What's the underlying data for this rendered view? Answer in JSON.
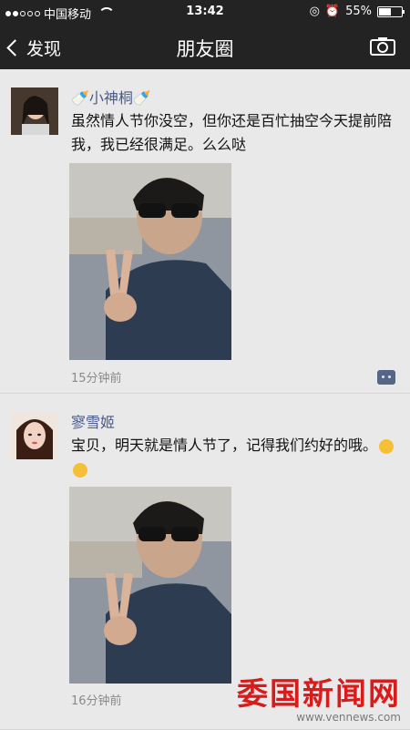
{
  "statusbar": {
    "carrier": "中国移动",
    "time": "13:42",
    "battery_text": "55%",
    "battery_level": 0.55
  },
  "navbar": {
    "back_label": "发现",
    "title": "朋友圈",
    "camera_icon": "camera-icon"
  },
  "posts": [
    {
      "author": "🍼小神桐🍼",
      "text": "虽然情人节你没空，但你还是百忙抽空今天提前陪我，我已经很满足。么么哒",
      "time": "15分钟前"
    },
    {
      "author": "寥雪姬",
      "text": "宝贝，明天就是情人节了，记得我们约好的哦",
      "text_tail": "。",
      "time": "16分钟前"
    }
  ],
  "watermark": {
    "cn": "委国新闻网",
    "url": "www.vennews.com"
  },
  "colors": {
    "nav_bg": "#232323",
    "name_blue": "#4a5a8a",
    "page_bg": "#e9e9e9",
    "watermark_red": "#d81c1c"
  }
}
